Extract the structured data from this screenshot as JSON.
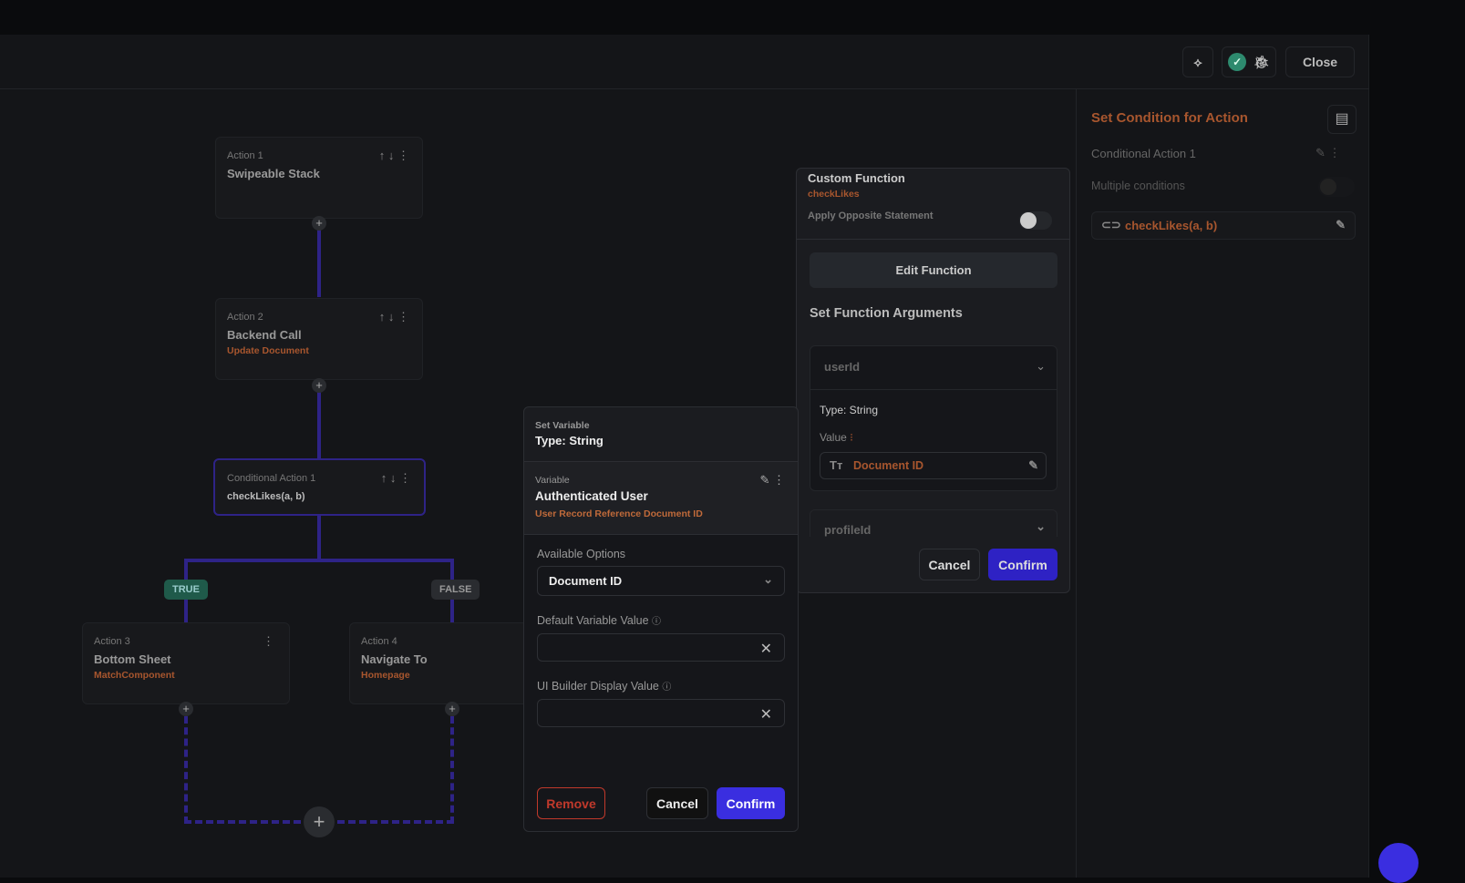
{
  "header": {
    "close_label": "Close"
  },
  "flow": {
    "actions": [
      {
        "num": "Action 1",
        "title": "Swipeable Stack",
        "sub": ""
      },
      {
        "num": "Action 2",
        "title": "Backend Call",
        "sub": "Update Document"
      },
      {
        "num": "Conditional Action 1",
        "title": "checkLikes(a, b)",
        "sub": ""
      },
      {
        "num": "Action 3",
        "title": "Bottom Sheet",
        "sub": "MatchComponent"
      },
      {
        "num": "Action 4",
        "title": "Navigate To",
        "sub": "Homepage"
      }
    ],
    "true_label": "TRUE",
    "false_label": "FALSE"
  },
  "right_panel": {
    "title": "Set Condition for Action",
    "conditional_name": "Conditional Action 1",
    "multiple_conditions": "Multiple conditions",
    "multiple_conditions_on": false,
    "condition": "checkLikes(a, b)"
  },
  "custom_function": {
    "header": "Custom Function",
    "name": "checkLikes",
    "apply_opposite": "Apply Opposite Statement",
    "apply_opposite_on": false,
    "edit_label": "Edit Function",
    "args_title": "Set Function Arguments",
    "args": [
      {
        "name": "userId",
        "type": "Type: String",
        "value_label": "Value",
        "value": "Document ID"
      },
      {
        "name": "profileId"
      }
    ],
    "cancel": "Cancel",
    "confirm": "Confirm"
  },
  "set_variable": {
    "header": "Set Variable",
    "type": "Type: String",
    "var_label": "Variable",
    "var_name": "Authenticated User",
    "var_path": "User Record Reference Document ID",
    "options_label": "Available Options",
    "selected_option": "Document ID",
    "default_label": "Default Variable Value",
    "default_value": "",
    "display_label": "UI Builder Display Value",
    "display_value": "",
    "remove": "Remove",
    "cancel": "Cancel",
    "confirm": "Confirm"
  },
  "colors": {
    "accent": "#3a2ee0",
    "orange": "#a8562e",
    "true_badge": "#1f5a4a"
  }
}
